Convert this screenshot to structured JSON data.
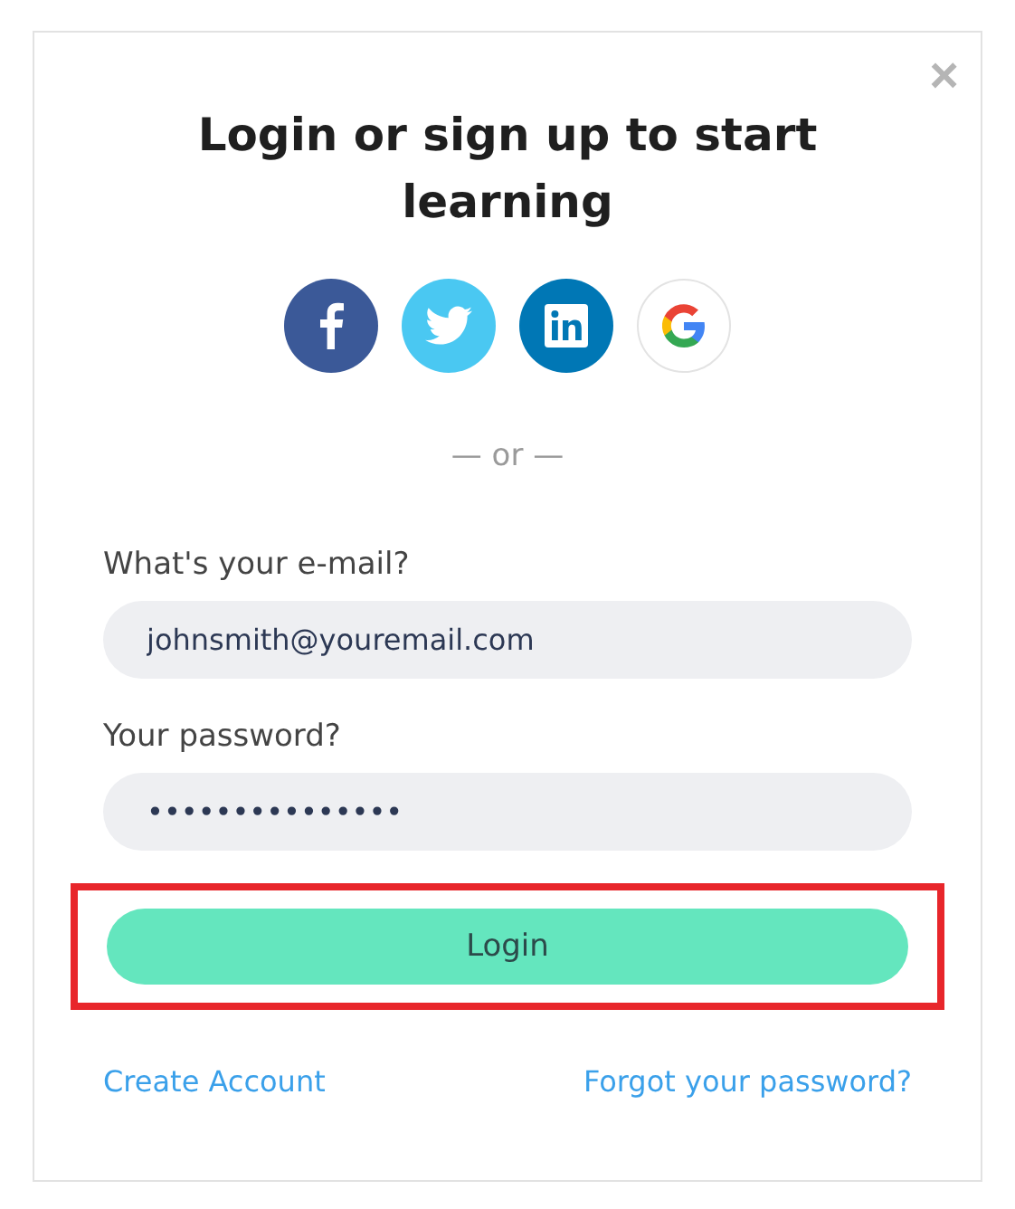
{
  "dialog": {
    "close": "×",
    "title": "Login or sign up to start learning"
  },
  "social_buttons": [
    {
      "kind": "facebook"
    },
    {
      "kind": "twitter"
    },
    {
      "kind": "linkedin"
    },
    {
      "kind": "google"
    }
  ],
  "divider": "— or —",
  "fields": [
    {
      "label": "What's your e-mail?",
      "value": "johnsmith@youremail.com"
    },
    {
      "label": "Your password?",
      "value": "•••••••••••••••"
    }
  ],
  "login_button": {
    "label": "Login",
    "highlighted": true
  },
  "links": [
    "Create Account",
    "Forgot your password?"
  ]
}
